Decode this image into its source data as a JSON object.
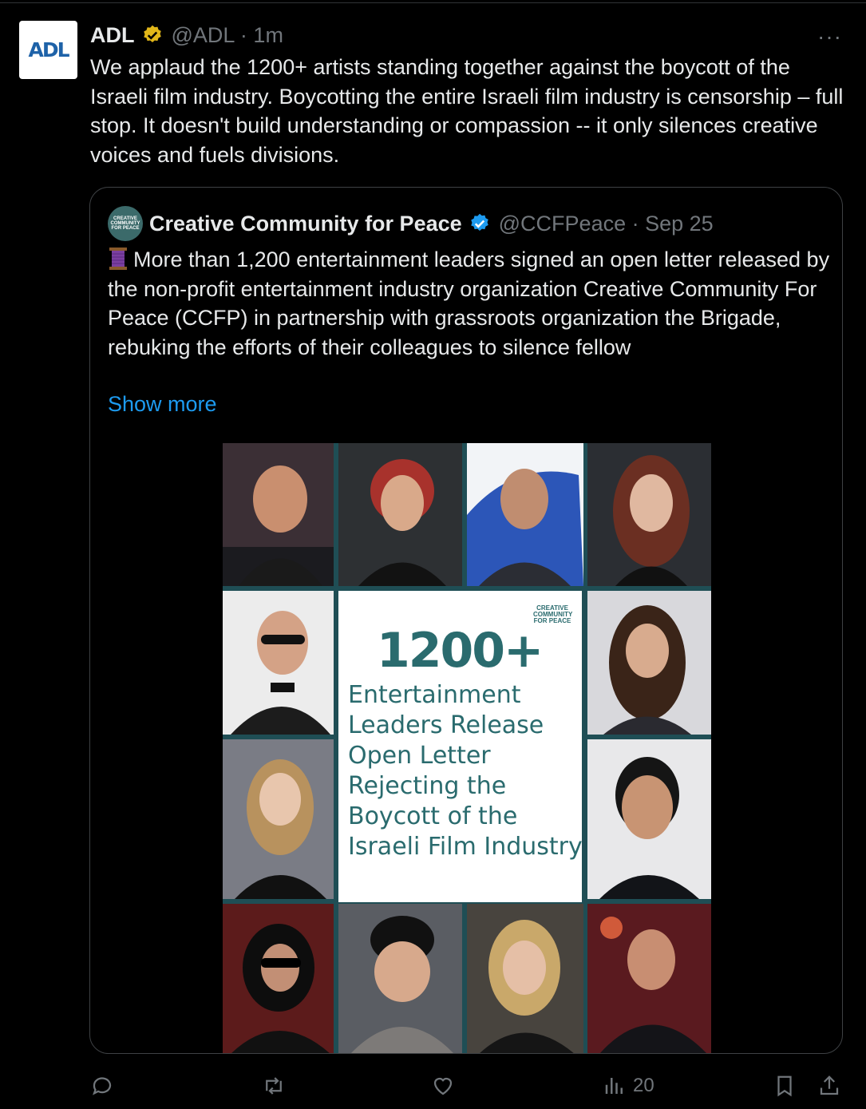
{
  "tweet": {
    "author_name": "ADL",
    "author_logo_text": "ADL",
    "handle_time": "@ADL · 1m",
    "more_label": "···",
    "text": "We applaud the 1200+ artists standing together against the boycott of the Israeli film industry. Boycotting the entire Israeli film industry is censorship – full stop. It doesn't build understanding or compassion -- it only silences creative voices and fuels divisions."
  },
  "quote": {
    "author_name": "Creative Community for Peace",
    "handle_time": "@CCFPeace · Sep 25",
    "avatar_text": "CREATIVE COMMUNITY FOR PEACE",
    "text": "More than 1,200 entertainment leaders signed an open letter released by the non-profit entertainment industry organization Creative Community For Peace (CCFP) in partnership with grassroots organization the Brigade, rebuking the efforts of their colleagues to silence fellow",
    "show_more": "Show more",
    "image": {
      "headline_number": "1200+",
      "headline_text": "Entertainment Leaders Release Open Letter Rejecting the Boycott of the Israeli Film Industry",
      "logo_text": "CREATIVE COMMUNITY FOR PEACE"
    }
  },
  "actions": {
    "reply_icon": "reply-icon",
    "repost_icon": "repost-icon",
    "like_icon": "like-icon",
    "views_icon": "views-icon",
    "views_count": "20",
    "bookmark_icon": "bookmark-icon",
    "share_icon": "share-icon"
  },
  "colors": {
    "background": "#000000",
    "text": "#e7e9ea",
    "secondary": "#71767b",
    "link": "#1d9bf0",
    "verified_gold": "#e2b719",
    "verified_blue": "#1d9bf0",
    "collage_teal": "#2a6b6e"
  }
}
